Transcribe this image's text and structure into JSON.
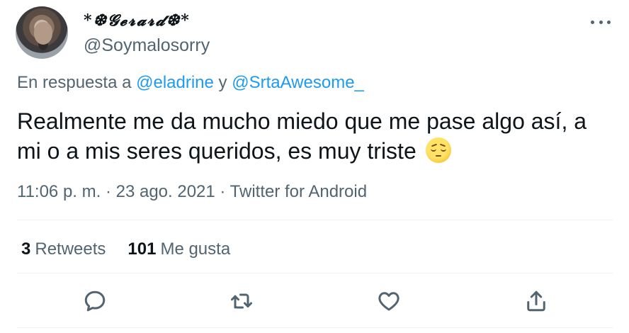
{
  "author": {
    "display_name": "*❆𝓖𝓮𝓻𝓪𝓻𝓭❆*",
    "handle": "@Soymalosorry"
  },
  "reply": {
    "prefix": "En respuesta a ",
    "mention1": "@eladrine",
    "joiner": " y ",
    "mention2": "@SrtaAwesome_"
  },
  "tweet": {
    "text": "Realmente me da mucho miedo que me pase algo así, a mi o a mis seres queridos, es muy triste ",
    "emoji": "pensive-face"
  },
  "meta": {
    "text": "11:06 p. m. · 23 ago. 2021 · Twitter for Android"
  },
  "stats": {
    "retweets_count": "3",
    "retweets_label": "Retweets",
    "likes_count": "101",
    "likes_label": "Me gusta"
  },
  "icons": {
    "reply": "reply-icon",
    "retweet": "retweet-icon",
    "like": "heart-icon",
    "share": "share-icon",
    "more": "more-icon"
  },
  "colors": {
    "text": "#0f1419",
    "secondary": "#536471",
    "link": "#1d9bf0",
    "divider": "#eff3f4"
  }
}
